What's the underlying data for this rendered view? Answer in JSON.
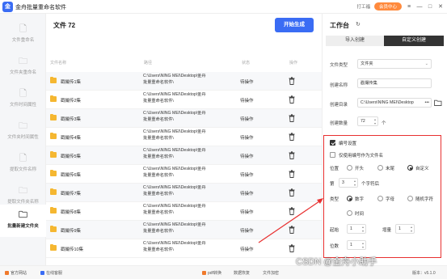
{
  "app": {
    "title": "金舟批量重命名软件",
    "logo_text": "金"
  },
  "titlebar": {
    "customer_service": "打工福",
    "vip_label": "会员中心",
    "menu_icon": "≡",
    "min_icon": "—",
    "max_icon": "□",
    "close_icon": "✕"
  },
  "sidebar": {
    "items": [
      {
        "label": "文件重命名",
        "icon": "file-icon"
      },
      {
        "label": "文件夹重命名",
        "icon": "folder-icon"
      },
      {
        "label": "文件时间属性",
        "icon": "file-clock-icon"
      },
      {
        "label": "文件夹时间属性",
        "icon": "folder-clock-icon"
      },
      {
        "label": "提取文件名称",
        "icon": "file-extract-icon"
      },
      {
        "label": "提取文件夹名称",
        "icon": "folder-extract-icon"
      },
      {
        "label": "批量新建文件夹",
        "icon": "new-folder-icon"
      }
    ]
  },
  "main": {
    "title": "文件 72",
    "generate_button": "开始生成",
    "columns": {
      "name": "文件名称",
      "path": "路径",
      "status": "状态",
      "action": "操作"
    },
    "rows": [
      {
        "name": "戳撮传1集",
        "path1": "C:\\Users\\NING MEI\\Desktop\\金舟",
        "path2": "批量重命名软件\\",
        "status": "待操作"
      },
      {
        "name": "戳撮传2集",
        "path1": "C:\\Users\\NING MEI\\Desktop\\金舟",
        "path2": "批量重命名软件\\",
        "status": "待操作"
      },
      {
        "name": "戳撮传3集",
        "path1": "C:\\Users\\NING MEI\\Desktop\\金舟",
        "path2": "批量重命名软件\\",
        "status": "待操作"
      },
      {
        "name": "戳撮传4集",
        "path1": "C:\\Users\\NING MEI\\Desktop\\金舟",
        "path2": "批量重命名软件\\",
        "status": "待操作"
      },
      {
        "name": "戳撮传5集",
        "path1": "C:\\Users\\NING MEI\\Desktop\\金舟",
        "path2": "批量重命名软件\\",
        "status": "待操作"
      },
      {
        "name": "戳撮传6集",
        "path1": "C:\\Users\\NING MEI\\Desktop\\金舟",
        "path2": "批量重命名软件\\",
        "status": "待操作"
      },
      {
        "name": "戳撮传7集",
        "path1": "C:\\Users\\NING MEI\\Desktop\\金舟",
        "path2": "批量重命名软件\\",
        "status": "待操作"
      },
      {
        "name": "戳撮传8集",
        "path1": "C:\\Users\\NING MEI\\Desktop\\金舟",
        "path2": "批量重命名软件\\",
        "status": "待操作"
      },
      {
        "name": "戳撮传9集",
        "path1": "C:\\Users\\NING MEI\\Desktop\\金舟",
        "path2": "批量重命名软件\\",
        "status": "待操作"
      },
      {
        "name": "戳撮传10集",
        "path1": "C:\\Users\\NING MEI\\Desktop\\金舟",
        "path2": "批量重命名软件\\",
        "status": "待操作"
      }
    ]
  },
  "panel": {
    "title": "工作台",
    "tabs": {
      "import": "导入创建",
      "custom": "自定义创建"
    },
    "file_type_label": "文件类型",
    "file_type_value": "文件夹",
    "create_name_label": "创建名称",
    "create_name_value": "戳撮传集",
    "create_dir_label": "创建目录",
    "create_dir_value": "C:\\Users\\NING MEI\\Desktop",
    "dots": "•••",
    "create_count_label": "创建数量",
    "create_count_value": "72",
    "count_unit": "个",
    "numbering_label": "编号设置",
    "only_number_label": "仅使用编号作为文件名",
    "position_label": "位置",
    "pos_start": "开头",
    "pos_end": "末尾",
    "pos_custom": "自定义",
    "nth_label": "第",
    "nth_value": "3",
    "nth_suffix": "个字符后",
    "type_label": "类型",
    "type_number": "数字",
    "type_letter": "字母",
    "type_random": "随机字符",
    "type_time": "时间",
    "start_label": "起始",
    "start_value": "1",
    "step_label": "增量",
    "step_value": "1",
    "digits_label": "位数",
    "digits_value": "1"
  },
  "footer": {
    "website": "官方网站",
    "consult": "在线客服",
    "pdf": "pdf转换",
    "recovery": "数据恢复",
    "encrypt": "文件加密",
    "version": "版本：v5.1.0"
  },
  "watermark": "CSDN @金舟小助手"
}
